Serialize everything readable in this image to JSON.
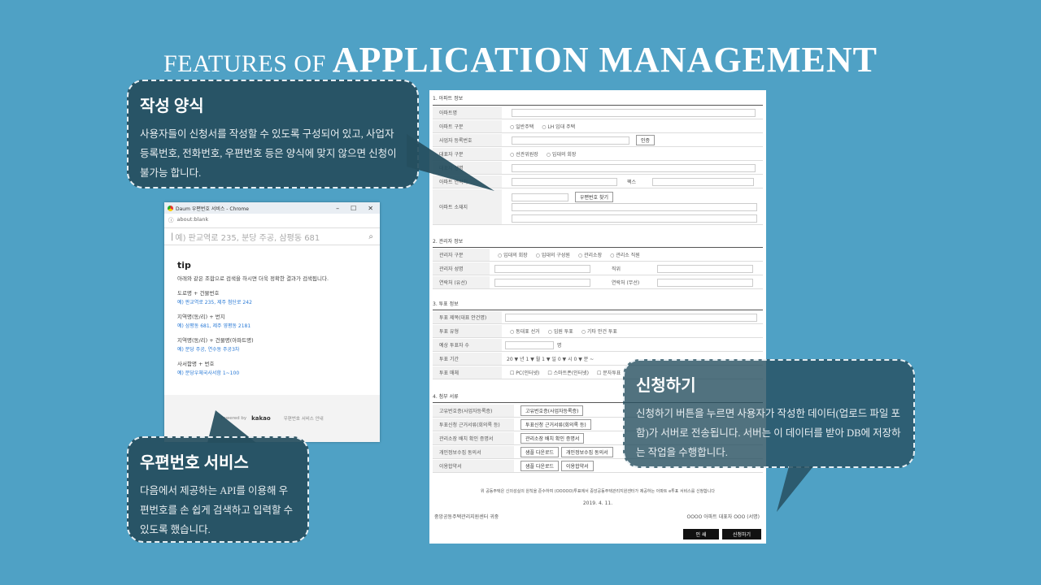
{
  "title": {
    "part1": "FEATURES OF ",
    "part2": "APPLICATION MANAGEMENT"
  },
  "callouts": {
    "form": {
      "heading": "작성 양식",
      "body": "사용자들이 신청서를 작성할 수 있도록 구성되어 있고, 사업자 등록번호, 전화번호, 우편번호 등은 양식에 맞지 않으면 신청이 불가능 합니다."
    },
    "postal": {
      "heading": "우편번호 서비스",
      "body": "다음에서 제공하는 API를 이용해 우편번호를 손 쉽게 검색하고 입력할 수 있도록 했습니다."
    },
    "apply": {
      "heading": "신청하기",
      "body": "신청하기 버튼을 누르면 사용자가 작성한 데이터(업로드 파일 포함)가 서버로 전송됩니다. 서버는 이 데이터를 받아 DB에 저장하는 작업을 수행합니다."
    }
  },
  "popup": {
    "window_title": "Daum 우편번호 서비스 - Chrome",
    "address": "about:blank",
    "search_placeholder": "예) 판교역로 235, 분당 주공, 삼평동 681",
    "tip_title": "tip",
    "tip_desc": "아래와 같은 조합으로 검색을 하시면 더욱 정확한 결과가 검색됩니다.",
    "examples": [
      {
        "h": "도로명 + 건물번호",
        "v": "예) 판교역로 235,  제주 첨단로 242"
      },
      {
        "h": "지역명(동/리) + 번지",
        "v": "예) 삼평동 681,  제주 영평동 2181"
      },
      {
        "h": "지역명(동/리) + 건물명(아파트명)",
        "v": "예) 분당 주공,  연수동 주공3차"
      },
      {
        "h": "사서함명 + 번호",
        "v": "예) 분당우체국사서함 1~100"
      }
    ],
    "footer_powered": "Powered by",
    "footer_brand": "kakao",
    "footer_guide": "우편번호 서비스 안내"
  },
  "form": {
    "sec1": "1. 아파트 정보",
    "apt_name": "아파트명",
    "apt_type": "아파트 구분",
    "apt_type_opts": [
      "일반주택",
      "LH 임대 주택"
    ],
    "biz_no": "사업자 등록번호",
    "auth_btn": "인증",
    "rep_type": "대표자 구분",
    "rep_type_opts": [
      "선관위원장",
      "입대의 회장"
    ],
    "rep_name": "대표자 성명",
    "apt_phone": "아파트 연락처",
    "fax": "팩스",
    "postal_btn": "우편번호 찾기",
    "apt_addr": "아파트 소재지",
    "sec2": "2. 관리자 정보",
    "mgr_type": "관리자 구분",
    "mgr_type_opts": [
      "입대의 회장",
      "입대의 구성원",
      "관리소장",
      "관리소 직원"
    ],
    "mgr_name": "관리자 성명",
    "position": "직위",
    "contact1": "연락처 (유선)",
    "contact2": "연락처 (무선)",
    "sec3": "3. 투표 정보",
    "vote_title": "투표 제목(대표 안건명)",
    "vote_type": "투표 유형",
    "vote_type_opts": [
      "동대표 선거",
      "임원 투표",
      "기타 안건 투표"
    ],
    "voters": "예상 투표자 수",
    "voters_unit": "명",
    "period": "투표 기간",
    "period_val": "20 ▼ 년  1 ▼ 월  1 ▼ 일  0 ▼ 시  0 ▼ 분  ~",
    "media": "투표 매체",
    "media_opts": [
      "PC(인터넷)",
      "스마트폰(인터넷)",
      "문자투표",
      "현장투표"
    ],
    "sec4": "4. 첨부 서류",
    "attach": [
      {
        "label": "고유번호증(사업자등록증)",
        "btns": [
          "고유번호증(사업자등록증)"
        ]
      },
      {
        "label": "투표신청 근거서류(회의록 등)",
        "btns": [
          "투표신청 근거서류(회의록 등)"
        ]
      },
      {
        "label": "관리소장 배치 확인 증명서",
        "btns": [
          "관리소장 배치 확인 증명서"
        ]
      },
      {
        "label": "개인정보수집 동의서",
        "btns": [
          "샘플 다운로드",
          "개인정보수집 동의서"
        ]
      },
      {
        "label": "이용합약서",
        "btns": [
          "샘플 다운로드",
          "이용합약서"
        ]
      }
    ],
    "notice": "위 공동주택은 신의성실의 원칙을 준수하여 (OOOOO)투표에서 중앙공동주택관리지원센터가 제공하는 아파트 e투표 서비스를 신청합니다",
    "date": "2019. 4. 11.",
    "center": "중앙공동주택관리지원센터 귀중",
    "signer": "OOOO 아파트 대표자 OOO (서명)",
    "print_btn": "인 쇄",
    "apply_btn": "신청하기"
  },
  "colors": {
    "background": "#4fa1c5",
    "callout": "#264f5f",
    "link": "#2a7ad6"
  }
}
